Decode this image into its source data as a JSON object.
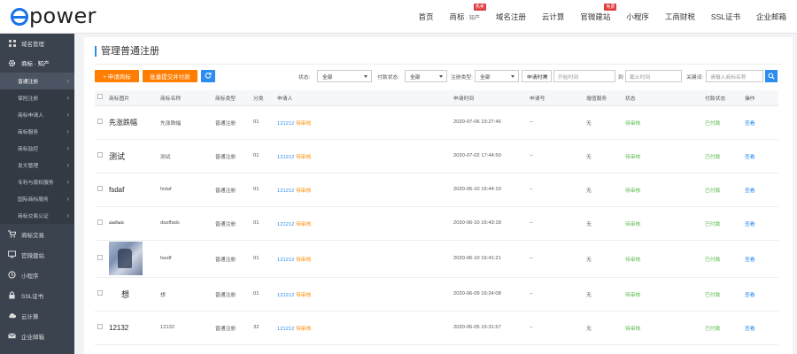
{
  "logo": {
    "text": "power"
  },
  "nav": {
    "items": [
      {
        "label": "首页"
      },
      {
        "label": "商标",
        "sub": " · 知产",
        "tag": "热卖"
      },
      {
        "label": "域名注册"
      },
      {
        "label": "云计算"
      },
      {
        "label": "官微建站",
        "tag": "免费"
      },
      {
        "label": "小程序"
      },
      {
        "label": "工商财税"
      },
      {
        "label": "SSL证书"
      },
      {
        "label": "企业邮箱"
      }
    ]
  },
  "sidebar": {
    "top": [
      {
        "label": "域名管理",
        "icon": "grid-icon"
      },
      {
        "label": "商标 · 知产",
        "icon": "gear-icon"
      }
    ],
    "subs": [
      {
        "label": "普通注册"
      },
      {
        "label": "保险注册"
      },
      {
        "label": "商标申请人"
      },
      {
        "label": "商标服务"
      },
      {
        "label": "商标监控"
      },
      {
        "label": "发文管理"
      },
      {
        "label": "专利与版权服务"
      },
      {
        "label": "国际商标服务"
      },
      {
        "label": "商标交易公证"
      }
    ],
    "bottom": [
      {
        "label": "商标交易",
        "icon": "cart-icon"
      },
      {
        "label": "官微建站",
        "icon": "monitor-icon"
      },
      {
        "label": "小程序",
        "icon": "clock-icon"
      },
      {
        "label": "SSL证书",
        "icon": "lock-icon"
      },
      {
        "label": "云计算",
        "icon": "cloud-icon"
      },
      {
        "label": "企业邮箱",
        "icon": "mail-icon"
      }
    ]
  },
  "page": {
    "title": "管理普通注册"
  },
  "toolbar": {
    "apply_label": "+ 申请商标",
    "batch_pay_label": "批量提交并付款",
    "refresh_icon": "refresh-icon"
  },
  "filters": {
    "status_label": "状态:",
    "status_value": "全部",
    "pay_status_label": "付款状态:",
    "pay_status_value": "全部",
    "reg_type_label": "注册类型:",
    "reg_type_value": "全部",
    "time_type_value": "申请时间",
    "start_placeholder": "开始时间",
    "to_label": "到",
    "end_placeholder": "截止时间",
    "keyword_label": "关键词:",
    "keyword_placeholder": "请输入商标名称"
  },
  "table": {
    "headers": [
      "",
      "商标图片",
      "商标名称",
      "商标类型",
      "分类",
      "申请人",
      "申请时间",
      "申请号",
      "增值服务",
      "状态",
      "付款状态",
      "操作"
    ],
    "rows": [
      {
        "image_text": "先涨跌幅",
        "name": "先涨跌幅",
        "type": "普通注册",
        "class": "01",
        "applicant": "121212",
        "applicant_status": "待审核",
        "time": "2020-07-06 15:27:46",
        "number": "--",
        "service": "无",
        "status": "待审核",
        "pay": "已付款",
        "action": "查看"
      },
      {
        "image_text": "测试",
        "name": "测试",
        "type": "普通注册",
        "class": "01",
        "applicant": "121212",
        "applicant_status": "待审核",
        "time": "2020-07-02 17:44:50",
        "number": "--",
        "service": "无",
        "status": "待审核",
        "pay": "已付款",
        "action": "查看"
      },
      {
        "image_text": "fsdaf",
        "name": "fsdaf",
        "type": "普通注册",
        "class": "01",
        "applicant": "121212",
        "applicant_status": "待审核",
        "time": "2020-06-10 16:44:10",
        "number": "--",
        "service": "无",
        "status": "待审核",
        "pay": "已付款",
        "action": "查看"
      },
      {
        "image_text": "dasffads",
        "name": "dasffads",
        "type": "普通注册",
        "class": "01",
        "applicant": "121212",
        "applicant_status": "待审核",
        "time": "2020-06-10 16:43:18",
        "number": "--",
        "service": "无",
        "status": "待审核",
        "pay": "已付款",
        "action": "查看"
      },
      {
        "image_text": "",
        "name": "fasdf",
        "type": "普通注册",
        "class": "01",
        "applicant": "121212",
        "applicant_status": "待审核",
        "time": "2020-06-10 16:41:21",
        "number": "--",
        "service": "无",
        "status": "待审核",
        "pay": "已付款",
        "action": "查看"
      },
      {
        "image_text": "想",
        "name": "想",
        "type": "普通注册",
        "class": "01",
        "applicant": "121212",
        "applicant_status": "待审核",
        "time": "2020-06-09 16:24:08",
        "number": "--",
        "service": "无",
        "status": "待审核",
        "pay": "已付款",
        "action": "查看"
      },
      {
        "image_text": "12132",
        "name": "12132",
        "type": "普通注册",
        "class": "32",
        "applicant": "121212",
        "applicant_status": "待审核",
        "time": "2020-06-05 15:31:57",
        "number": "--",
        "service": "无",
        "status": "待审核",
        "pay": "已付款",
        "action": "查看"
      }
    ]
  },
  "colors": {
    "accent": "#2d8cf0",
    "orange": "#ff7d00",
    "sidebar": "#3b434f",
    "green": "#58b94a"
  }
}
